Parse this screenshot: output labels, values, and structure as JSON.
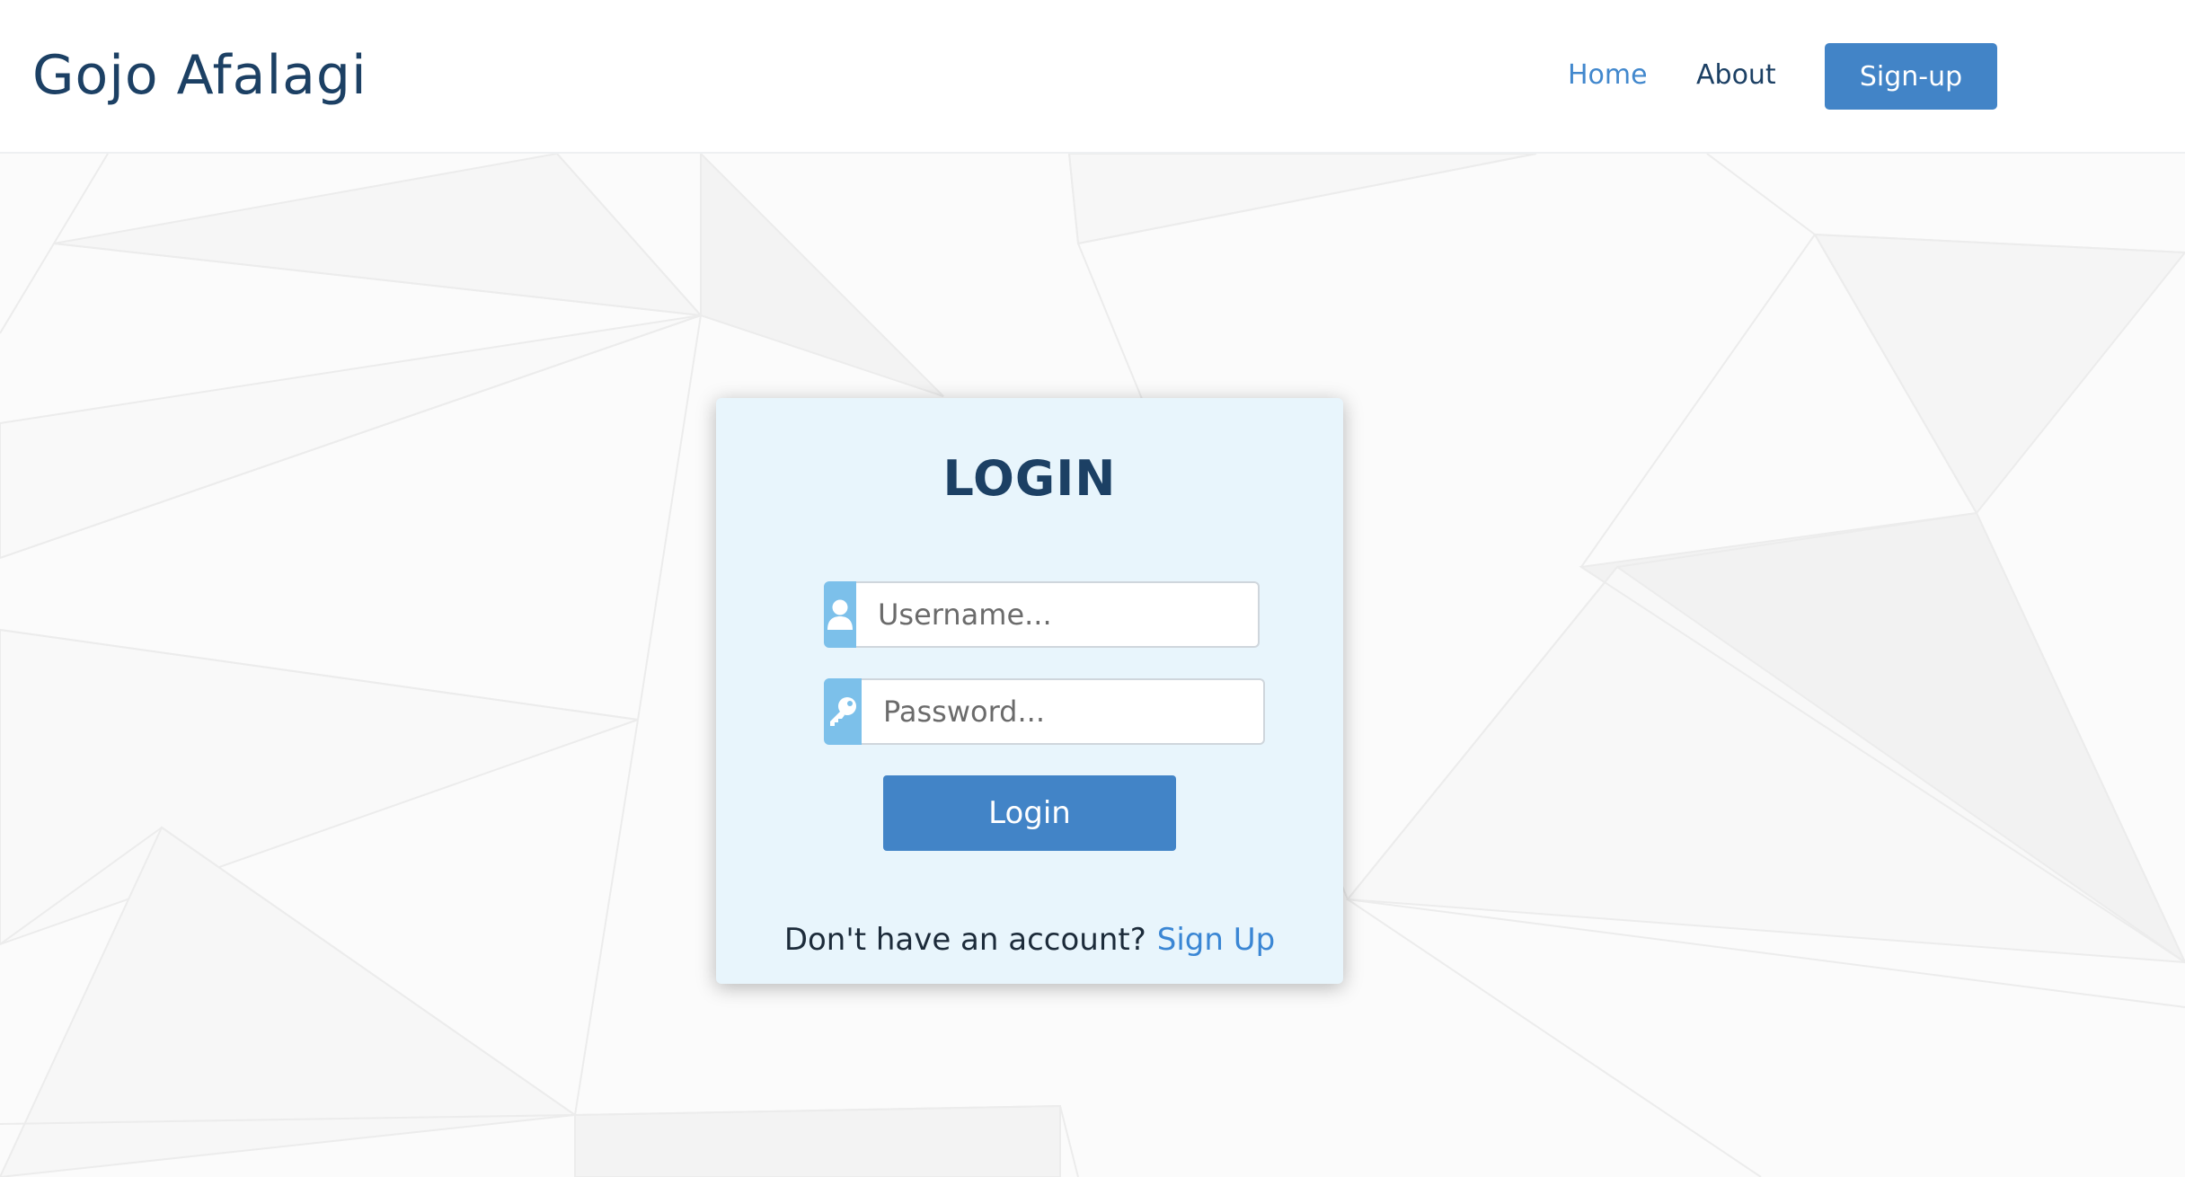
{
  "header": {
    "brand": "Gojo Afalagi",
    "nav": {
      "home": "Home",
      "about": "About",
      "signup": "Sign-up"
    }
  },
  "login": {
    "title": "LOGIN",
    "username_placeholder": "Username...",
    "password_placeholder": "Password...",
    "submit_label": "Login",
    "no_account_text": "Don't have an account?",
    "signup_link": "Sign Up"
  },
  "colors": {
    "brand_text": "#1c4064",
    "accent": "#4284c7",
    "icon_bg": "#7cc0ea",
    "card_bg": "#e8f5fc"
  },
  "icons": {
    "username": "user-icon",
    "password": "key-icon"
  }
}
